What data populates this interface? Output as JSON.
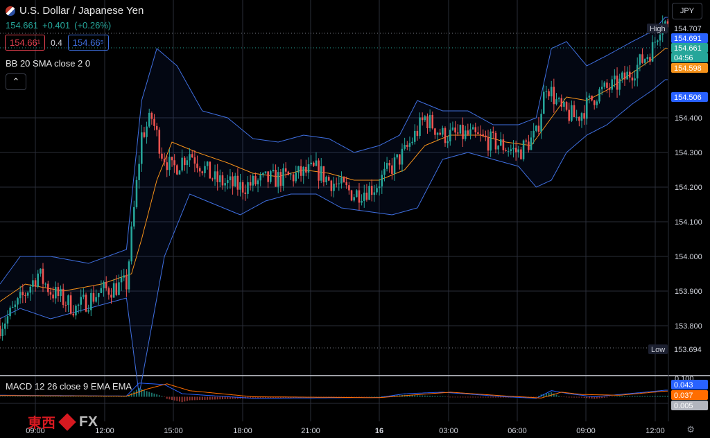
{
  "header": {
    "pair": "U.S. Dollar / Japanese Yen",
    "last": "154.661",
    "change": "+0.401",
    "change_pct": "(+0.26%)",
    "sell": "154.66¹",
    "spread": "0.4",
    "buy": "154.66⁵",
    "indicator": "BB 20 SMA close 2 0",
    "collapse": "⌃",
    "currency": "JPY"
  },
  "macd": {
    "label": "MACD 12 26 close 9 EMA EMA"
  },
  "logo": {
    "ja": "東西",
    "fx": "FX"
  },
  "settings_icon": "gear-icon",
  "colors": {
    "up": "#26a69a",
    "down": "#ef5350",
    "bb": "#3f6fe0",
    "sma": "#f7931a",
    "macd_line": "#2962ff",
    "signal_line": "#ff6d00"
  },
  "chart_data": {
    "type": "candlestick",
    "price_axis": {
      "min": 153.66,
      "max": 154.74,
      "ticks": [
        154.4,
        154.3,
        154.2,
        154.1,
        154.0,
        153.9,
        153.8
      ]
    },
    "time_labels": [
      "09:00",
      "12:00",
      "15:00",
      "18:00",
      "21:00",
      "16",
      "03:00",
      "06:00",
      "09:00",
      "12:00"
    ],
    "price_labels": [
      {
        "text": "High",
        "value": "154.707",
        "kind": "high"
      },
      {
        "text": "",
        "value": "154.691",
        "kind": "bb_upper"
      },
      {
        "text": "",
        "value": "154.661",
        "kind": "last"
      },
      {
        "text": "",
        "value": "04:56",
        "kind": "countdown"
      },
      {
        "text": "",
        "value": "154.598",
        "kind": "sma"
      },
      {
        "text": "",
        "value": "154.506",
        "kind": "bb_lower"
      },
      {
        "text": "Low",
        "value": "153.694",
        "kind": "low"
      }
    ],
    "close_path": [
      [
        0,
        153.8
      ],
      [
        6,
        153.85
      ],
      [
        15,
        153.95
      ],
      [
        20,
        153.9
      ],
      [
        30,
        153.85
      ],
      [
        40,
        153.9
      ],
      [
        50,
        153.92
      ],
      [
        56,
        154.35
      ],
      [
        60,
        154.4
      ],
      [
        64,
        154.3
      ],
      [
        68,
        154.25
      ],
      [
        75,
        154.3
      ],
      [
        85,
        154.22
      ],
      [
        95,
        154.2
      ],
      [
        105,
        154.22
      ],
      [
        115,
        154.23
      ],
      [
        125,
        154.25
      ],
      [
        130,
        154.22
      ],
      [
        140,
        154.18
      ],
      [
        148,
        154.2
      ],
      [
        154,
        154.25
      ],
      [
        160,
        154.3
      ],
      [
        168,
        154.4
      ],
      [
        175,
        154.35
      ],
      [
        185,
        154.35
      ],
      [
        195,
        154.33
      ],
      [
        205,
        154.3
      ],
      [
        212,
        154.35
      ],
      [
        216,
        154.5
      ],
      [
        222,
        154.42
      ],
      [
        228,
        154.4
      ],
      [
        236,
        154.47
      ],
      [
        245,
        154.5
      ],
      [
        252,
        154.55
      ],
      [
        258,
        154.6
      ],
      [
        262,
        154.69
      ],
      [
        264,
        154.66
      ]
    ],
    "bb_upper": [
      [
        0,
        153.92
      ],
      [
        8,
        154.0
      ],
      [
        20,
        154.0
      ],
      [
        35,
        153.98
      ],
      [
        50,
        154.02
      ],
      [
        56,
        154.45
      ],
      [
        62,
        154.6
      ],
      [
        70,
        154.55
      ],
      [
        80,
        154.42
      ],
      [
        90,
        154.4
      ],
      [
        100,
        154.34
      ],
      [
        110,
        154.33
      ],
      [
        120,
        154.35
      ],
      [
        130,
        154.34
      ],
      [
        140,
        154.3
      ],
      [
        150,
        154.32
      ],
      [
        158,
        154.35
      ],
      [
        165,
        154.45
      ],
      [
        175,
        154.42
      ],
      [
        185,
        154.42
      ],
      [
        195,
        154.38
      ],
      [
        205,
        154.38
      ],
      [
        212,
        154.4
      ],
      [
        218,
        154.6
      ],
      [
        224,
        154.62
      ],
      [
        232,
        154.55
      ],
      [
        240,
        154.58
      ],
      [
        250,
        154.62
      ],
      [
        258,
        154.65
      ],
      [
        263,
        154.69
      ]
    ],
    "bb_lower": [
      [
        0,
        153.82
      ],
      [
        8,
        153.85
      ],
      [
        20,
        153.82
      ],
      [
        35,
        153.85
      ],
      [
        50,
        153.88
      ],
      [
        55,
        153.6
      ],
      [
        58,
        153.72
      ],
      [
        65,
        154.0
      ],
      [
        75,
        154.18
      ],
      [
        85,
        154.15
      ],
      [
        95,
        154.12
      ],
      [
        105,
        154.16
      ],
      [
        115,
        154.18
      ],
      [
        125,
        154.18
      ],
      [
        135,
        154.14
      ],
      [
        145,
        154.13
      ],
      [
        155,
        154.12
      ],
      [
        165,
        154.14
      ],
      [
        175,
        154.28
      ],
      [
        185,
        154.3
      ],
      [
        195,
        154.28
      ],
      [
        205,
        154.26
      ],
      [
        212,
        154.2
      ],
      [
        218,
        154.22
      ],
      [
        224,
        154.3
      ],
      [
        232,
        154.35
      ],
      [
        240,
        154.38
      ],
      [
        250,
        154.44
      ],
      [
        258,
        154.48
      ],
      [
        263,
        154.51
      ]
    ],
    "sma": [
      [
        0,
        153.87
      ],
      [
        10,
        153.92
      ],
      [
        25,
        153.9
      ],
      [
        40,
        153.92
      ],
      [
        52,
        153.95
      ],
      [
        56,
        154.05
      ],
      [
        62,
        154.22
      ],
      [
        68,
        154.33
      ],
      [
        78,
        154.3
      ],
      [
        90,
        154.27
      ],
      [
        100,
        154.24
      ],
      [
        110,
        154.23
      ],
      [
        120,
        154.25
      ],
      [
        130,
        154.24
      ],
      [
        140,
        154.22
      ],
      [
        150,
        154.22
      ],
      [
        160,
        154.25
      ],
      [
        168,
        154.32
      ],
      [
        178,
        154.35
      ],
      [
        190,
        154.35
      ],
      [
        200,
        154.33
      ],
      [
        210,
        154.32
      ],
      [
        216,
        154.38
      ],
      [
        224,
        154.46
      ],
      [
        232,
        154.45
      ],
      [
        240,
        154.48
      ],
      [
        250,
        154.53
      ],
      [
        258,
        154.57
      ],
      [
        263,
        154.6
      ]
    ],
    "macd_line": [
      [
        0,
        0.01
      ],
      [
        50,
        0.005
      ],
      [
        55,
        0.09
      ],
      [
        65,
        0.08
      ],
      [
        72,
        0.02
      ],
      [
        100,
        -0.01
      ],
      [
        150,
        -0.005
      ],
      [
        160,
        0.02
      ],
      [
        175,
        0.03
      ],
      [
        200,
        0.0
      ],
      [
        212,
        -0.01
      ],
      [
        218,
        0.04
      ],
      [
        225,
        0.02
      ],
      [
        235,
        0.0
      ],
      [
        255,
        0.03
      ],
      [
        263,
        0.043
      ]
    ],
    "signal_line": [
      [
        0,
        0.008
      ],
      [
        50,
        0.004
      ],
      [
        58,
        0.05
      ],
      [
        66,
        0.085
      ],
      [
        75,
        0.04
      ],
      [
        100,
        0.0
      ],
      [
        150,
        -0.006
      ],
      [
        162,
        0.01
      ],
      [
        178,
        0.03
      ],
      [
        200,
        0.005
      ],
      [
        214,
        -0.008
      ],
      [
        222,
        0.03
      ],
      [
        230,
        0.015
      ],
      [
        245,
        0.01
      ],
      [
        263,
        0.037
      ]
    ],
    "macd_values": {
      "macd": "0.043",
      "signal": "0.037",
      "hist": "0.005",
      "top_tick": "0.100"
    }
  }
}
